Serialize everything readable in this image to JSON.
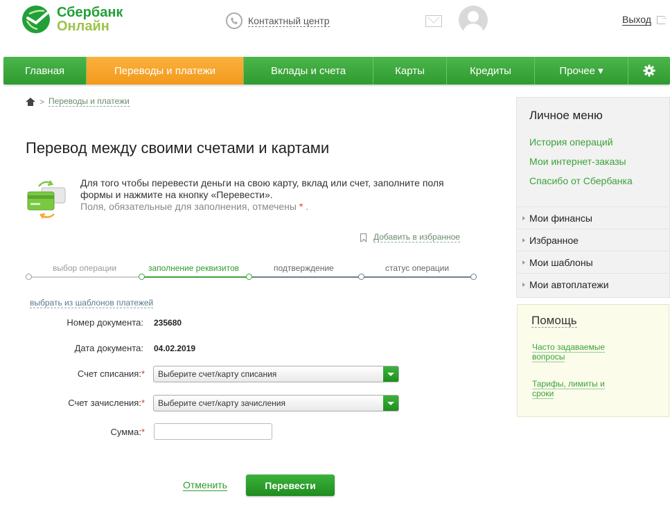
{
  "header": {
    "logo_line1": "Сбербанк",
    "logo_line2": "Онлайн",
    "contact_center": "Контактный центр",
    "logout": "Выход"
  },
  "nav": {
    "items": [
      {
        "label": "Главная"
      },
      {
        "label": "Переводы и платежи",
        "active": true
      },
      {
        "label": "Вклады и счета"
      },
      {
        "label": "Карты"
      },
      {
        "label": "Кредиты"
      },
      {
        "label": "Прочее ▾"
      }
    ],
    "settings_icon": "gear-icon"
  },
  "breadcrumb": {
    "current": "Переводы и платежи"
  },
  "page": {
    "title": "Перевод между своими счетами и картами",
    "info_text": "Для того чтобы перевести деньги на свою карту, вклад или счет, заполните поля формы и нажмите на кнопку «Перевести».",
    "required_note": "Поля, обязательные для заполнения, отмечены",
    "required_mark": "*",
    "add_favorite": "Добавить в избранное",
    "steps": [
      {
        "label": "выбор операции",
        "state": "done"
      },
      {
        "label": "заполнение реквизитов",
        "state": "active"
      },
      {
        "label": "подтверждение",
        "state": "next"
      },
      {
        "label": "статус операции",
        "state": "next"
      }
    ],
    "templates_link": "выбрать из шаблонов платежей"
  },
  "form": {
    "doc_number_label": "Номер документа:",
    "doc_number": "235680",
    "doc_date_label": "Дата документа:",
    "doc_date": "04.02.2019",
    "from_label": "Счет списания:",
    "from_value": "Выберите счет/карту списания",
    "to_label": "Счет зачисления:",
    "to_value": "Выберите счет/карту зачисления",
    "amount_label": "Сумма:",
    "amount_value": "",
    "req": "*",
    "cancel": "Отменить",
    "submit": "Перевести"
  },
  "sidebar": {
    "title": "Личное меню",
    "links": [
      "История операций",
      "Мои интернет-заказы",
      "Спасибо от Сбербанка"
    ],
    "items": [
      "Мои финансы",
      "Избранное",
      "Мои шаблоны",
      "Мои автоплатежи"
    ]
  },
  "help": {
    "title": "Помощь",
    "links": [
      "Часто задаваемые вопросы",
      "Тарифы, лимиты и сроки"
    ]
  },
  "colors": {
    "brand_green": "#21a038",
    "nav_active": "#f29a1d",
    "required": "#e4322b"
  }
}
